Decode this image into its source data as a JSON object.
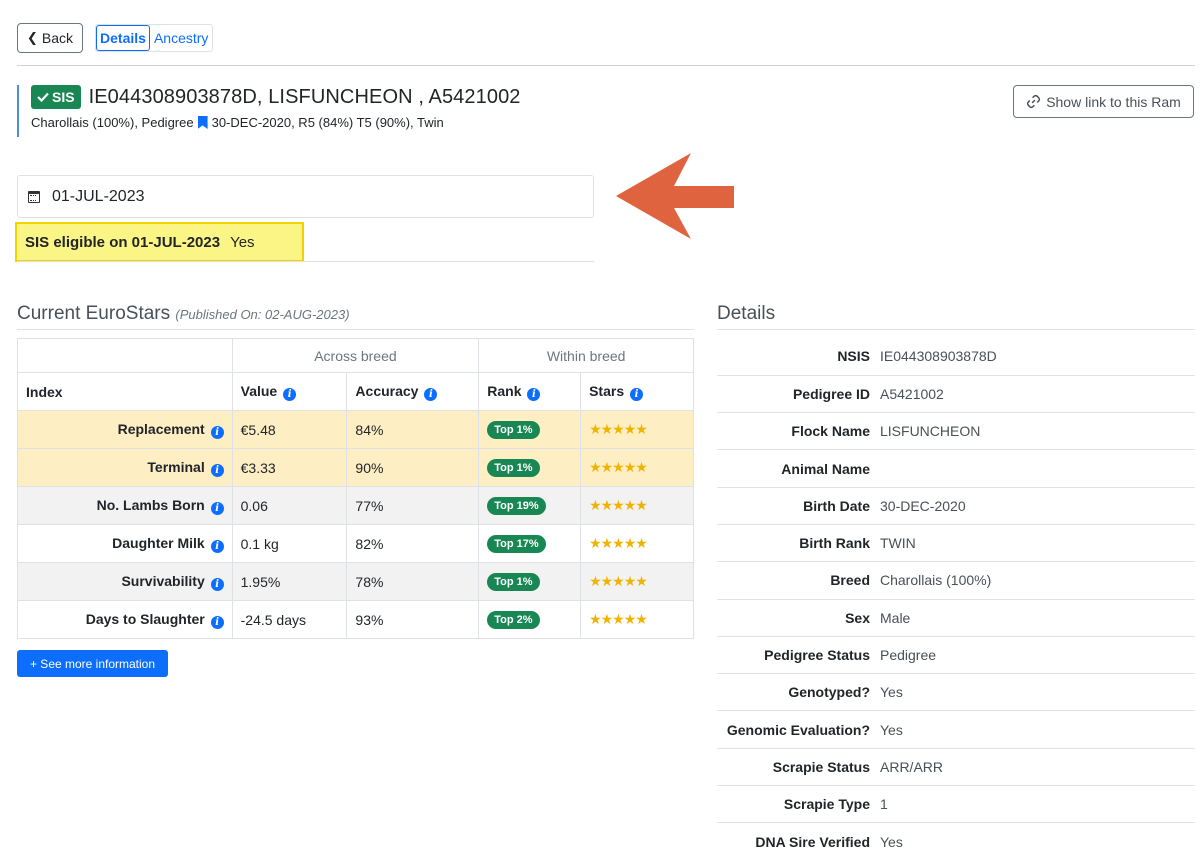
{
  "nav": {
    "back_label": "Back",
    "tabs": [
      {
        "label": "Details",
        "active": true
      },
      {
        "label": "Ancestry",
        "active": false
      }
    ]
  },
  "animal": {
    "badge": "SIS",
    "title": "IE044308903878D, LISFUNCHEON , A5421002",
    "subtitle_left": "Charollais (100%), Pedigree",
    "subtitle_right": "30-DEC-2020, R5 (84%) T5 (90%), Twin",
    "link_button": "Show link to this Ram"
  },
  "date_picker": {
    "value": "01-JUL-2023"
  },
  "sis_eligibility": {
    "label": "SIS eligible on 01-JUL-2023",
    "value": "Yes"
  },
  "eurostars": {
    "title": "Current EuroStars",
    "published": "(Published On: 02-AUG-2023)",
    "group_headers": {
      "across": "Across breed",
      "within": "Within breed"
    },
    "columns": [
      "Index",
      "Value",
      "Accuracy",
      "Rank",
      "Stars"
    ],
    "rows": [
      {
        "index": "Replacement",
        "value": "€5.48",
        "accuracy": "84%",
        "rank": "Top 1%",
        "stars": "★★★★★",
        "stars_count": 5,
        "style": "highlight"
      },
      {
        "index": "Terminal",
        "value": "€3.33",
        "accuracy": "90%",
        "rank": "Top 1%",
        "stars": "★★★★★",
        "stars_count": 5,
        "style": "highlight"
      },
      {
        "index": "No. Lambs Born",
        "value": "0.06",
        "accuracy": "77%",
        "rank": "Top 19%",
        "stars": "★★★★★",
        "stars_count": 5,
        "style": "gray"
      },
      {
        "index": "Daughter Milk",
        "value": "0.1 kg",
        "accuracy": "82%",
        "rank": "Top 17%",
        "stars": "★★★★★",
        "stars_count": 5,
        "style": "white"
      },
      {
        "index": "Survivability",
        "value": "1.95%",
        "accuracy": "78%",
        "rank": "Top 1%",
        "stars": "★★★★★",
        "stars_count": 5,
        "style": "gray"
      },
      {
        "index": "Days to Slaughter",
        "value": "-24.5 days",
        "accuracy": "93%",
        "rank": "Top 2%",
        "stars": "★★★★★",
        "stars_count": 5,
        "style": "white"
      }
    ],
    "more_button": "+ See more information"
  },
  "details": {
    "title": "Details",
    "rows": [
      {
        "key": "NSIS",
        "value": "IE044308903878D"
      },
      {
        "key": "Pedigree ID",
        "value": "A5421002"
      },
      {
        "key": "Flock Name",
        "value": "LISFUNCHEON"
      },
      {
        "key": "Animal Name",
        "value": ""
      },
      {
        "key": "Birth Date",
        "value": "30-DEC-2020"
      },
      {
        "key": "Birth Rank",
        "value": "TWIN"
      },
      {
        "key": "Breed",
        "value": "Charollais (100%)"
      },
      {
        "key": "Sex",
        "value": "Male"
      },
      {
        "key": "Pedigree Status",
        "value": "Pedigree"
      },
      {
        "key": "Genotyped?",
        "value": "Yes"
      },
      {
        "key": "Genomic Evaluation?",
        "value": "Yes"
      },
      {
        "key": "Scrapie Status",
        "value": "ARR/ARR"
      },
      {
        "key": "Scrapie Type",
        "value": "1"
      },
      {
        "key": "DNA Sire Verified",
        "value": "Yes"
      }
    ]
  },
  "colors": {
    "primary": "#0d6efd",
    "success": "#198754",
    "highlight_row": "#fdeec4",
    "eligible_bg": "#fbf585",
    "arrow": "#e0633f",
    "star": "#f0b400"
  }
}
